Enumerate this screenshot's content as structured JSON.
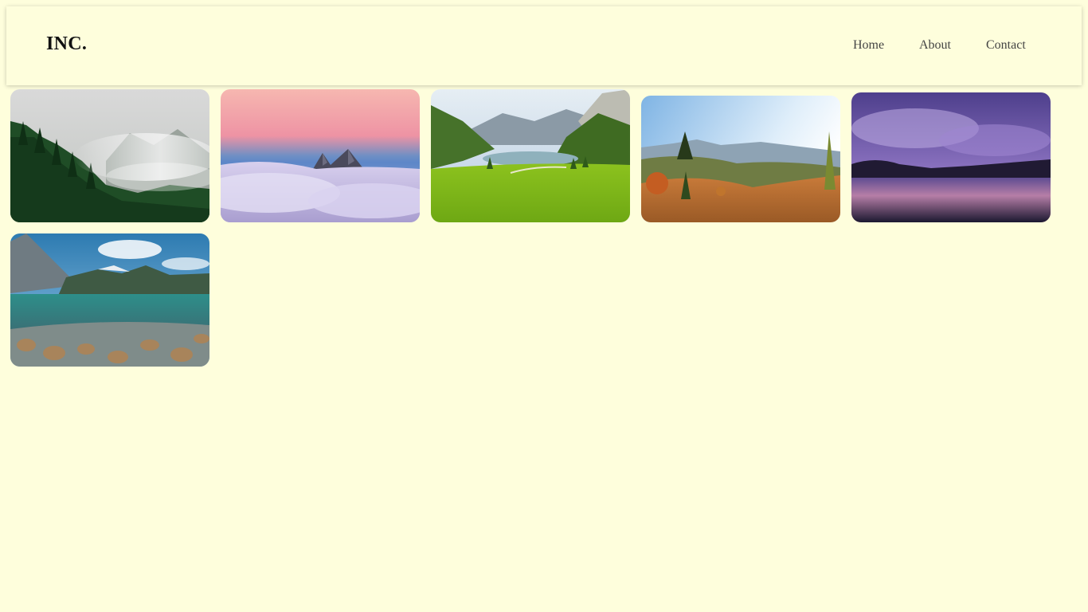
{
  "header": {
    "logo": "INC.",
    "nav": [
      {
        "label": "Home"
      },
      {
        "label": "About"
      },
      {
        "label": "Contact"
      }
    ]
  },
  "gallery": {
    "photos": [
      {
        "subject": "misty-forest"
      },
      {
        "subject": "peaks-above-clouds"
      },
      {
        "subject": "alpine-lake-meadow"
      },
      {
        "subject": "autumn-hills-sunrise"
      },
      {
        "subject": "purple-sunset-lake"
      },
      {
        "subject": "mountain-lake-rocks"
      }
    ]
  },
  "colors": {
    "background": "#fefedc",
    "nav_text": "#444444",
    "logo_text": "#111111"
  }
}
